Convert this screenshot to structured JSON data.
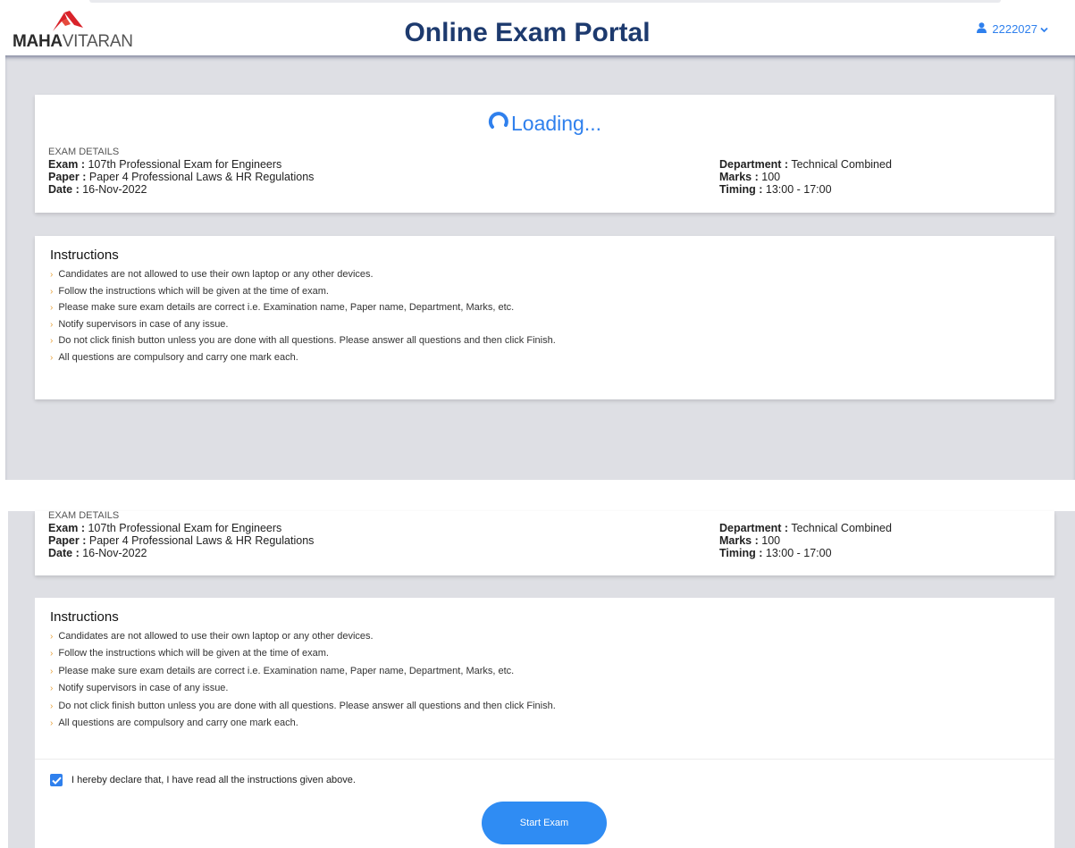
{
  "header": {
    "logo_bold": "MAHA",
    "logo_regular": "VITARAN",
    "title": "Online Exam Portal",
    "user_id": "2222027"
  },
  "loading": {
    "text": "Loading..."
  },
  "exam_details": {
    "heading": "EXAM DETAILS",
    "exam_label": "Exam :",
    "exam_value": "107th Professional Exam for Engineers",
    "paper_label": "Paper :",
    "paper_value": "Paper 4 Professional Laws & HR Regulations",
    "date_label": "Date :",
    "date_value": "16-Nov-2022",
    "department_label": "Department :",
    "department_value": "Technical Combined",
    "marks_label": "Marks :",
    "marks_value": "100",
    "timing_label": "Timing :",
    "timing_value": "13:00 - 17:00"
  },
  "instructions": {
    "title": "Instructions",
    "items": [
      "Candidates are not allowed to use their own laptop or any other devices.",
      "Follow the instructions which will be given at the time of exam.",
      "Please make sure exam details are correct i.e. Examination name, Paper name, Department, Marks, etc.",
      "Notify supervisors in case of any issue.",
      "Do not click finish button unless you are done with all questions. Please answer all questions and then click Finish.",
      "All questions are compulsory and carry one mark each."
    ]
  },
  "declaration": {
    "text": "I hereby declare that, I have read all the instructions given above.",
    "checked": true
  },
  "start_button": {
    "label": "Start Exam"
  },
  "colors": {
    "accent": "#2f80ed",
    "title": "#1d3a6e",
    "background": "#dedfe4",
    "bullet": "#e8a33d",
    "logo_red": "#d9232a"
  }
}
